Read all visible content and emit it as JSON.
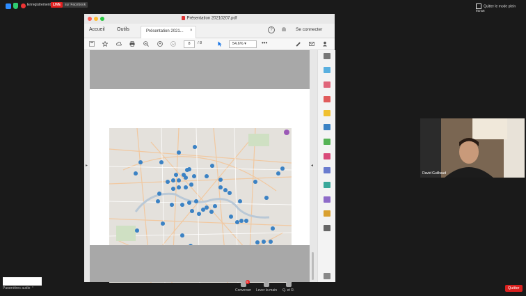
{
  "zoom_bar": {
    "recording_label": "Enregistrement",
    "live_label": "LIVE",
    "facebook_label": "sur Facebook",
    "fullscreen_label": "Quitter le mode plein écran"
  },
  "acrobat": {
    "window_title": "Présentation 20210207.pdf",
    "tabs": {
      "home": "Accueil",
      "tools": "Outils"
    },
    "doc_tab_label": "Présentation 2021...",
    "doc_tab_close": "×",
    "help_symbol": "?",
    "connect_label": "Se connecter",
    "page_current": "8",
    "page_total": "/ 8",
    "zoom_level": "54,6%",
    "more_label": "•••"
  },
  "webcam": {
    "participant_name": "David Guilbaud"
  },
  "bottom": {
    "audio_settings": "Paramètres audio",
    "controls": [
      {
        "label": "Converser",
        "badge": "6"
      },
      {
        "label": "Lever la main"
      },
      {
        "label": "Q. et R."
      }
    ],
    "quit_label": "Quitter"
  },
  "colors": {
    "accent": "#2d8cff",
    "live": "#e02020",
    "quit": "#d9201e",
    "pin": "#3b82c4"
  }
}
